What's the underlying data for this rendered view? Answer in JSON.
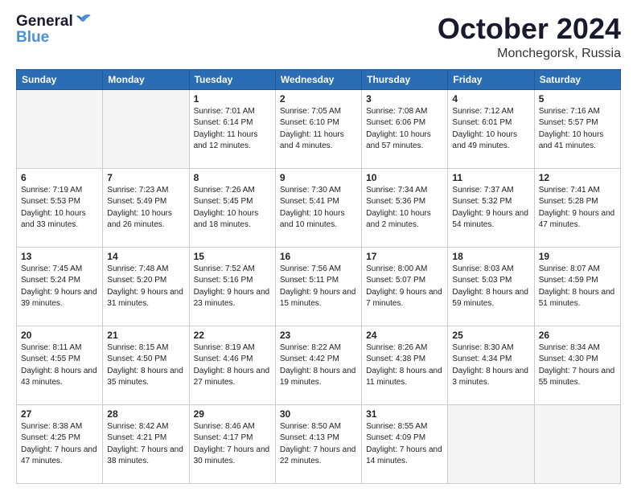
{
  "header": {
    "logo_general": "General",
    "logo_blue": "Blue",
    "title": "October 2024",
    "subtitle": "Monchegorsk, Russia"
  },
  "calendar": {
    "days_of_week": [
      "Sunday",
      "Monday",
      "Tuesday",
      "Wednesday",
      "Thursday",
      "Friday",
      "Saturday"
    ],
    "weeks": [
      [
        {
          "day": "",
          "info": ""
        },
        {
          "day": "",
          "info": ""
        },
        {
          "day": "1",
          "info": "Sunrise: 7:01 AM\nSunset: 6:14 PM\nDaylight: 11 hours\nand 12 minutes."
        },
        {
          "day": "2",
          "info": "Sunrise: 7:05 AM\nSunset: 6:10 PM\nDaylight: 11 hours\nand 4 minutes."
        },
        {
          "day": "3",
          "info": "Sunrise: 7:08 AM\nSunset: 6:06 PM\nDaylight: 10 hours\nand 57 minutes."
        },
        {
          "day": "4",
          "info": "Sunrise: 7:12 AM\nSunset: 6:01 PM\nDaylight: 10 hours\nand 49 minutes."
        },
        {
          "day": "5",
          "info": "Sunrise: 7:16 AM\nSunset: 5:57 PM\nDaylight: 10 hours\nand 41 minutes."
        }
      ],
      [
        {
          "day": "6",
          "info": "Sunrise: 7:19 AM\nSunset: 5:53 PM\nDaylight: 10 hours\nand 33 minutes."
        },
        {
          "day": "7",
          "info": "Sunrise: 7:23 AM\nSunset: 5:49 PM\nDaylight: 10 hours\nand 26 minutes."
        },
        {
          "day": "8",
          "info": "Sunrise: 7:26 AM\nSunset: 5:45 PM\nDaylight: 10 hours\nand 18 minutes."
        },
        {
          "day": "9",
          "info": "Sunrise: 7:30 AM\nSunset: 5:41 PM\nDaylight: 10 hours\nand 10 minutes."
        },
        {
          "day": "10",
          "info": "Sunrise: 7:34 AM\nSunset: 5:36 PM\nDaylight: 10 hours\nand 2 minutes."
        },
        {
          "day": "11",
          "info": "Sunrise: 7:37 AM\nSunset: 5:32 PM\nDaylight: 9 hours\nand 54 minutes."
        },
        {
          "day": "12",
          "info": "Sunrise: 7:41 AM\nSunset: 5:28 PM\nDaylight: 9 hours\nand 47 minutes."
        }
      ],
      [
        {
          "day": "13",
          "info": "Sunrise: 7:45 AM\nSunset: 5:24 PM\nDaylight: 9 hours\nand 39 minutes."
        },
        {
          "day": "14",
          "info": "Sunrise: 7:48 AM\nSunset: 5:20 PM\nDaylight: 9 hours\nand 31 minutes."
        },
        {
          "day": "15",
          "info": "Sunrise: 7:52 AM\nSunset: 5:16 PM\nDaylight: 9 hours\nand 23 minutes."
        },
        {
          "day": "16",
          "info": "Sunrise: 7:56 AM\nSunset: 5:11 PM\nDaylight: 9 hours\nand 15 minutes."
        },
        {
          "day": "17",
          "info": "Sunrise: 8:00 AM\nSunset: 5:07 PM\nDaylight: 9 hours\nand 7 minutes."
        },
        {
          "day": "18",
          "info": "Sunrise: 8:03 AM\nSunset: 5:03 PM\nDaylight: 8 hours\nand 59 minutes."
        },
        {
          "day": "19",
          "info": "Sunrise: 8:07 AM\nSunset: 4:59 PM\nDaylight: 8 hours\nand 51 minutes."
        }
      ],
      [
        {
          "day": "20",
          "info": "Sunrise: 8:11 AM\nSunset: 4:55 PM\nDaylight: 8 hours\nand 43 minutes."
        },
        {
          "day": "21",
          "info": "Sunrise: 8:15 AM\nSunset: 4:50 PM\nDaylight: 8 hours\nand 35 minutes."
        },
        {
          "day": "22",
          "info": "Sunrise: 8:19 AM\nSunset: 4:46 PM\nDaylight: 8 hours\nand 27 minutes."
        },
        {
          "day": "23",
          "info": "Sunrise: 8:22 AM\nSunset: 4:42 PM\nDaylight: 8 hours\nand 19 minutes."
        },
        {
          "day": "24",
          "info": "Sunrise: 8:26 AM\nSunset: 4:38 PM\nDaylight: 8 hours\nand 11 minutes."
        },
        {
          "day": "25",
          "info": "Sunrise: 8:30 AM\nSunset: 4:34 PM\nDaylight: 8 hours\nand 3 minutes."
        },
        {
          "day": "26",
          "info": "Sunrise: 8:34 AM\nSunset: 4:30 PM\nDaylight: 7 hours\nand 55 minutes."
        }
      ],
      [
        {
          "day": "27",
          "info": "Sunrise: 8:38 AM\nSunset: 4:25 PM\nDaylight: 7 hours\nand 47 minutes."
        },
        {
          "day": "28",
          "info": "Sunrise: 8:42 AM\nSunset: 4:21 PM\nDaylight: 7 hours\nand 38 minutes."
        },
        {
          "day": "29",
          "info": "Sunrise: 8:46 AM\nSunset: 4:17 PM\nDaylight: 7 hours\nand 30 minutes."
        },
        {
          "day": "30",
          "info": "Sunrise: 8:50 AM\nSunset: 4:13 PM\nDaylight: 7 hours\nand 22 minutes."
        },
        {
          "day": "31",
          "info": "Sunrise: 8:55 AM\nSunset: 4:09 PM\nDaylight: 7 hours\nand 14 minutes."
        },
        {
          "day": "",
          "info": ""
        },
        {
          "day": "",
          "info": ""
        }
      ]
    ]
  }
}
